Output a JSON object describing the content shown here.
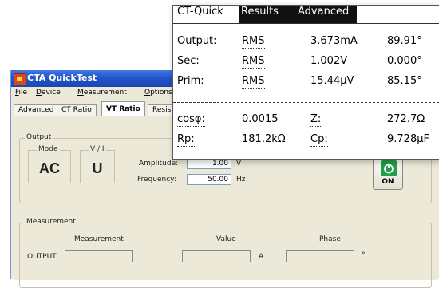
{
  "window": {
    "title": "CTA QuickTest",
    "menu": [
      {
        "underline": "F",
        "rest": "ile"
      },
      {
        "underline": "D",
        "rest": "evice"
      },
      {
        "underline": "M",
        "rest": "easurement"
      },
      {
        "underline": "O",
        "rest": "ptions"
      }
    ],
    "tabs": [
      "Advanced",
      "CT Ratio",
      "VT Ratio",
      "Resista"
    ],
    "active_tab": "VT Ratio"
  },
  "output": {
    "group_label": "Output",
    "mode_label": "Mode",
    "mode_value": "AC",
    "vi_label": "V / I",
    "vi_value": "U",
    "amplitude_label": "Amplitude:",
    "amplitude_value": "1.00",
    "amplitude_unit": "V",
    "frequency_label": "Frequency:",
    "frequency_value": "50.00",
    "frequency_unit": "Hz",
    "on_button": "ON"
  },
  "measurement": {
    "group_label": "Measurement",
    "col_measurement": "Measurement",
    "col_value": "Value",
    "col_phase": "Phase",
    "row_label": "OUTPUT",
    "value_unit": "A",
    "phase_unit": "°"
  },
  "popup": {
    "tabs": [
      "CT-Quick",
      "Results",
      "Advanced"
    ],
    "active_tabs": [
      "Results",
      "Advanced"
    ],
    "rows": [
      {
        "label": "Output:",
        "type": "RMS",
        "value": "3.673mA",
        "phase": "89.91°"
      },
      {
        "label": "Sec:",
        "type": "RMS",
        "value": "1.002V",
        "phase": "0.000°"
      },
      {
        "label": "Prim:",
        "type": "RMS",
        "value": "15.44µV",
        "phase": "85.15°"
      }
    ],
    "extra": [
      {
        "label": "cosφ:",
        "value": "0.0015",
        "label2": "Z:",
        "value2": "272.7Ω"
      },
      {
        "label": "Rp:",
        "value": "181.2kΩ",
        "label2": "Cp:",
        "value2": "9.728µF"
      }
    ]
  },
  "colors": {
    "titlebar": "#2356c8",
    "window_face": "#ece9d8",
    "on_icon": "#1fa048",
    "popup_tab_active": "#111111"
  },
  "icons": {
    "app": "app-icon",
    "power": "power-icon"
  }
}
